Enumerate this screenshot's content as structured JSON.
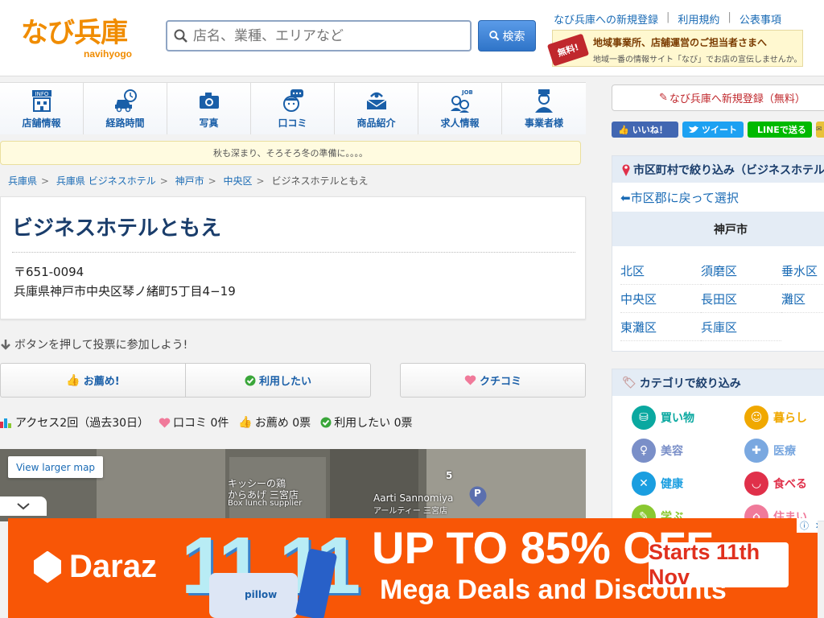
{
  "header": {
    "logo_main": "なび兵庫",
    "logo_sub": "navihyogo",
    "search_placeholder": "店名、業種、エリアなど",
    "search_button": "検索",
    "top_links": [
      "なび兵庫への新規登録",
      "利用規約",
      "公表事項"
    ],
    "banner": {
      "free_tag": "無料!",
      "line1": "地域事業所、店舗運営のご担当者さまへ",
      "line2": "地域一番の情報サイト「なび」でお店の宣伝しませんか。"
    }
  },
  "nav": [
    {
      "label": "店舗情報",
      "icon": "info-building-icon"
    },
    {
      "label": "経路時間",
      "icon": "car-clock-icon"
    },
    {
      "label": "写真",
      "icon": "camera-icon"
    },
    {
      "label": "口コミ",
      "icon": "chat-face-icon"
    },
    {
      "label": "商品紹介",
      "icon": "gift-icon"
    },
    {
      "label": "求人情報",
      "icon": "job-people-icon"
    },
    {
      "label": "事業者様",
      "icon": "business-person-icon"
    }
  ],
  "notice": "秋も深まり、そろそろ冬の準備に。。。。",
  "breadcrumb": [
    "兵庫県",
    "兵庫県 ビジネスホテル",
    "神戸市",
    "中央区",
    "ビジネスホテルともえ"
  ],
  "shop": {
    "name": "ビジネスホテルともえ",
    "postal": "〒651-0094",
    "address": "兵庫県神戸市中央区琴ノ緒町5丁目4−19"
  },
  "vote": {
    "hint": "ボタンを押して投票に参加しよう!",
    "recommend": "お薦め!",
    "want_use": "利用したい",
    "review": "クチコミ"
  },
  "stats": {
    "access": "アクセス2回（過去30日）",
    "reviews": "口コミ 0件",
    "recommend": "お薦め 0票",
    "want_use": "利用したい 0票"
  },
  "map": {
    "larger_link": "View larger map",
    "labels": [
      "キッシーの鶏",
      "からあげ 三宮店",
      "Box lunch supplier",
      "Aarti Sannomiya",
      "アールティー 三宮店",
      "5"
    ]
  },
  "sidebar": {
    "register": "なび兵庫へ新規登録（無料）",
    "social": [
      "いいね！",
      "ツイート",
      "LINEで送る"
    ],
    "area_head": "市区町村で絞り込み（ビジネスホテル",
    "back_link": "⬅市区郡に戻って選択",
    "city": "神戸市",
    "wards": [
      "北区",
      "須磨区",
      "垂水区",
      "中央区",
      "長田区",
      "灘区",
      "東灘区",
      "兵庫区"
    ],
    "category_head": "カテゴリで絞り込み",
    "categories": [
      {
        "label": "買い物",
        "color": "#0aa8a0"
      },
      {
        "label": "暮らし",
        "color": "#f0a800"
      },
      {
        "label": "美容",
        "color": "#7a8fc8"
      },
      {
        "label": "医療",
        "color": "#7aa8e0"
      },
      {
        "label": "健康",
        "color": "#1a9ee0"
      },
      {
        "label": "食べる",
        "color": "#e0304a"
      },
      {
        "label": "学ぶ",
        "color": "#8ac830"
      },
      {
        "label": "住まい",
        "color": "#f07a9a"
      }
    ]
  },
  "ad": {
    "brand": "Daraz",
    "big": "11.11",
    "headline": "UP TO  85% OFF",
    "sub": "Mega Deals and Discounts",
    "cta": "Starts 11th Nov",
    "pillow": "pillow"
  }
}
